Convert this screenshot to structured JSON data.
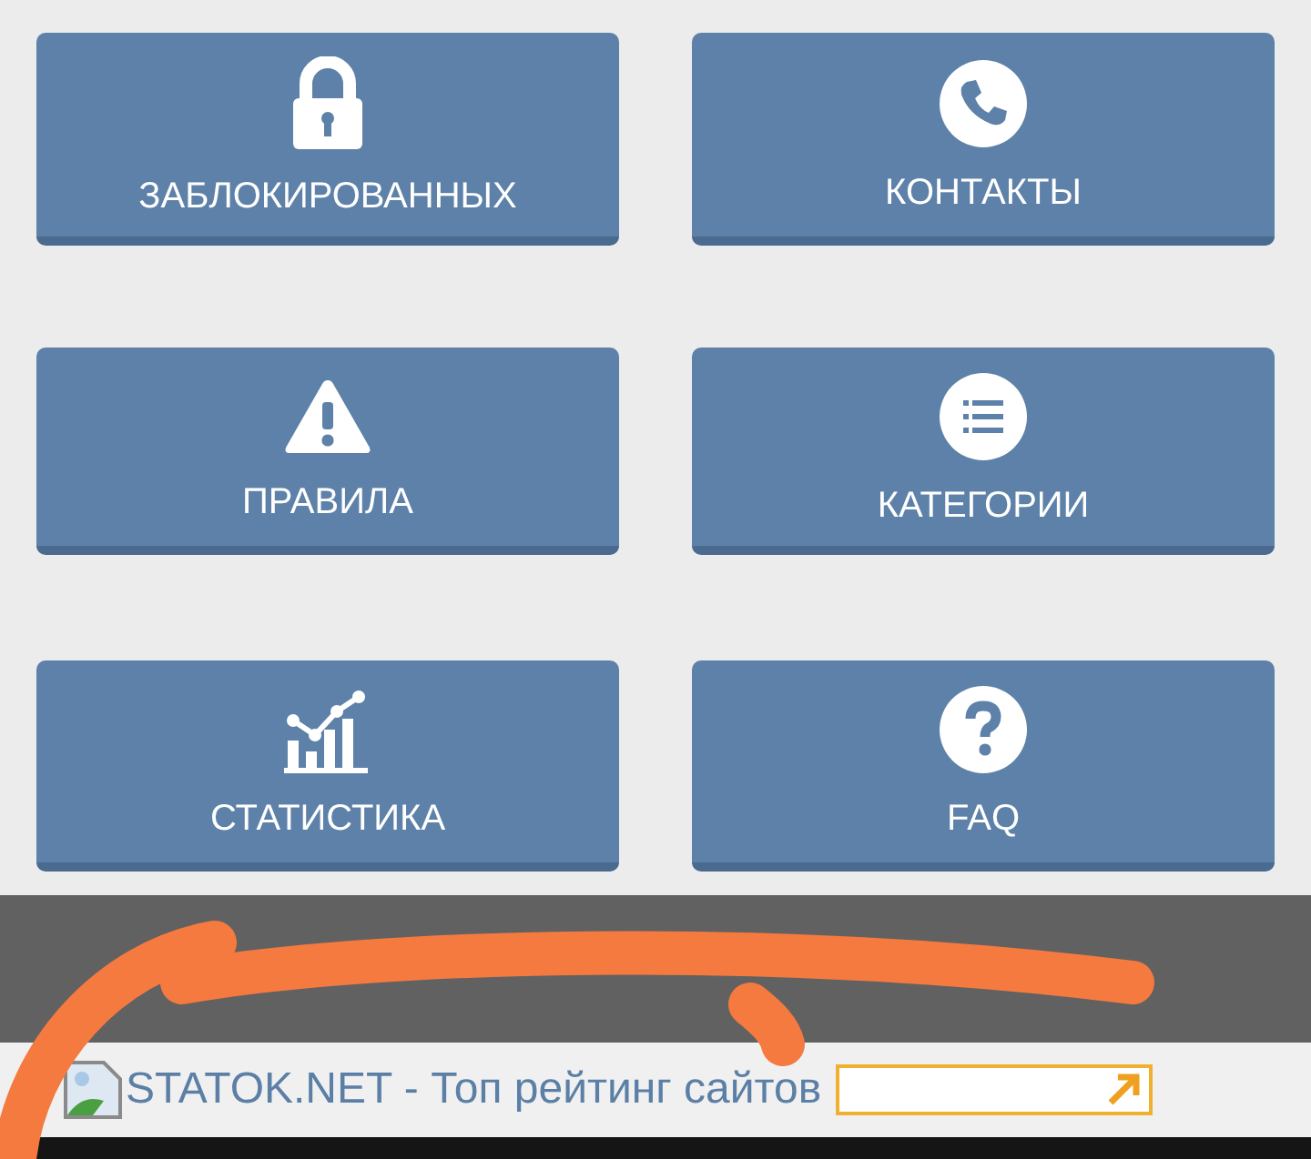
{
  "tiles": [
    {
      "label": "ЗАБЛОКИРОВАННЫХ"
    },
    {
      "label": "КОНТАКТЫ"
    },
    {
      "label": "ПРАВИЛА"
    },
    {
      "label": "КАТЕГОРИИ"
    },
    {
      "label": "СТАТИСТИКА"
    },
    {
      "label": "FAQ"
    }
  ],
  "banner": {
    "link": "STATOK.NET - Топ рейтинг сайтов"
  }
}
